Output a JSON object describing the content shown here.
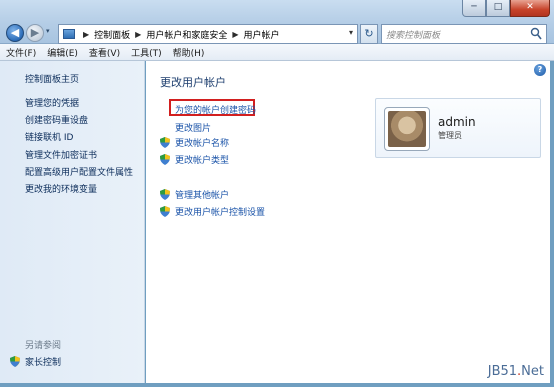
{
  "window": {
    "minimize_glyph": "─",
    "maximize_glyph": "□",
    "close_glyph": "✕"
  },
  "nav": {
    "back_glyph": "◀",
    "forward_glyph": "▶",
    "dropdown_glyph": "▾"
  },
  "address": {
    "crumbs": [
      "控制面板",
      "用户帐户和家庭安全",
      "用户帐户"
    ],
    "separator": "▶",
    "refresh_glyph": "↻"
  },
  "search": {
    "placeholder": "搜索控制面板"
  },
  "menu": {
    "file": "文件(F)",
    "edit": "编辑(E)",
    "view": "查看(V)",
    "tools": "工具(T)",
    "help": "帮助(H)"
  },
  "sidebar": {
    "home": "控制面板主页",
    "items": [
      "管理您的凭据",
      "创建密码重设盘",
      "链接联机 ID",
      "管理文件加密证书",
      "配置高级用户配置文件属性",
      "更改我的环境变量"
    ],
    "see_also": "另请参阅",
    "parental_controls": "家长控制"
  },
  "main": {
    "help_glyph": "?",
    "title": "更改用户帐户",
    "tasks": {
      "create_password": "为您的帐户创建密码",
      "change_picture": "更改图片",
      "change_name": "更改帐户名称",
      "change_type": "更改帐户类型",
      "manage_other": "管理其他帐户",
      "uac_settings": "更改用户帐户控制设置"
    }
  },
  "user": {
    "name": "admin",
    "role": "管理员"
  },
  "watermark": {
    "prefix": "JB51",
    "dot": ".",
    "suffix": "Net"
  },
  "colors": {
    "highlight_box": "#d21f1f",
    "link": "#1a53a8"
  }
}
